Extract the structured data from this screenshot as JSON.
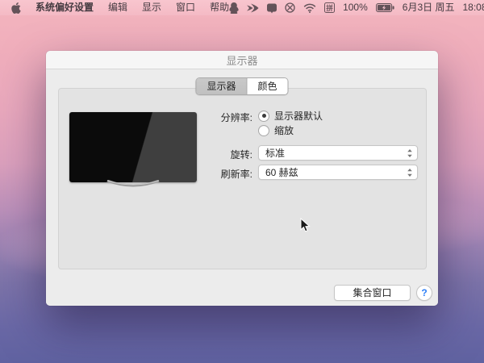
{
  "menubar": {
    "menus": [
      {
        "label": "系统偏好设置"
      },
      {
        "label": "编辑"
      },
      {
        "label": "显示"
      },
      {
        "label": "窗口"
      },
      {
        "label": "帮助"
      }
    ],
    "status": {
      "input_method_label": "拼",
      "battery_percent": "100%",
      "date": "6月3日 周五",
      "time": "18:08"
    }
  },
  "window": {
    "title": "显示器",
    "tabs": [
      {
        "label": "显示器",
        "selected": true
      },
      {
        "label": "颜色",
        "selected": false
      }
    ],
    "resolution": {
      "label": "分辨率:",
      "options": [
        {
          "label": "显示器默认",
          "selected": true
        },
        {
          "label": "缩放",
          "selected": false
        }
      ]
    },
    "rotation": {
      "label": "旋转:",
      "value": "标准"
    },
    "refresh": {
      "label": "刷新率:",
      "value": "60 赫兹"
    },
    "footer": {
      "gather_windows": "集合窗口",
      "help": "?"
    }
  },
  "colors": {
    "desktop_top": "#f3b5be",
    "desktop_bottom": "#6062a1",
    "window_bg": "#ececec",
    "groupbox_bg": "#e3e3e3",
    "selected_segment": "#c4c4c4",
    "help_blue": "#2d7ff7",
    "monitor_screen": "#0b0b0b"
  }
}
